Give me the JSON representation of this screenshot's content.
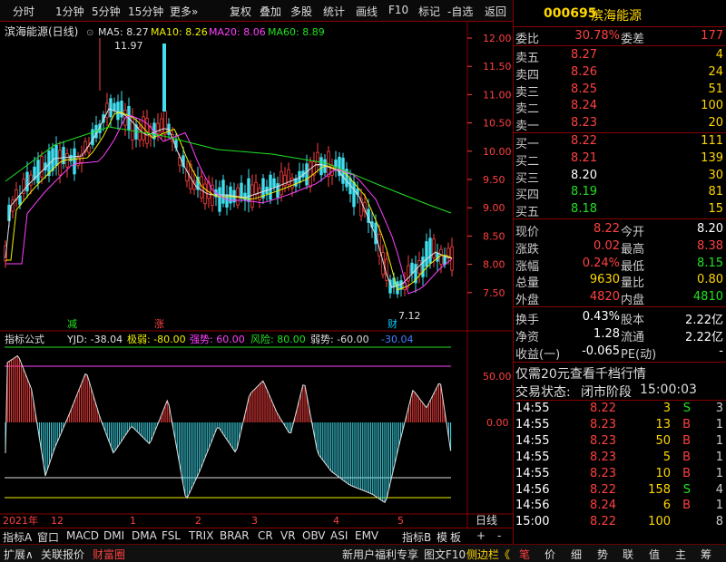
{
  "toolbar": {
    "items": [
      "分时",
      "1分钟",
      "5分钟",
      "15分钟",
      "更多»",
      "复权",
      "叠加",
      "多股",
      "统计",
      "画线",
      "F10",
      "标记",
      "-自选",
      "返回"
    ]
  },
  "chart_header": {
    "title": "滨海能源(日线)",
    "ma5": "MA5: 8.27",
    "ma10": "MA10: 8.26",
    "ma20": "MA20: 8.06",
    "ma60": "MA60: 8.89",
    "high_label": "11.97",
    "low_label": "7.12",
    "mark_jian": "减",
    "mark_zhang": "涨",
    "mark_cai": "财"
  },
  "price_axis": [
    "12.00",
    "11.50",
    "11.00",
    "10.50",
    "10.00",
    "9.50",
    "9.00",
    "8.50",
    "8.00",
    "7.50"
  ],
  "indicator": {
    "name": "指标公式",
    "yjd": "YJD: -38.04",
    "jiruo": "极弱: -80.00",
    "qiangshi": "强势: 60.00",
    "fengxian": "风险: 80.00",
    "ruoshi": "弱势: -60.00",
    "value": "-30.04",
    "axis": [
      "50.00",
      "0.00"
    ]
  },
  "time_axis": {
    "labels": [
      "2021年",
      "12",
      "1",
      "2",
      "3",
      "4",
      "5"
    ],
    "mode": "日线"
  },
  "tabs": [
    "指标A",
    "窗口",
    "MACD",
    "DMI",
    "DMA",
    "FSL",
    "TRIX",
    "BRAR",
    "CR",
    "VR",
    "OBV",
    "ASI",
    "EMV",
    "指标B",
    "模",
    "板",
    "+",
    "-"
  ],
  "footer": {
    "left": [
      "扩展∧",
      "关联报价",
      "财富圈"
    ],
    "news": "新用户福利专享",
    "f10": "图文F10",
    "side": "侧边栏《",
    "right_tabs": [
      "笔",
      "价",
      "细",
      "势",
      "联",
      "值",
      "主",
      "筹"
    ]
  },
  "quote": {
    "code": "000695",
    "name": "滨海能源",
    "weibi_label": "委比",
    "weibi": "30.78%",
    "weicha_label": "委差",
    "weicha": "177",
    "asks": [
      {
        "label": "卖五",
        "price": "8.27",
        "vol": "4"
      },
      {
        "label": "卖四",
        "price": "8.26",
        "vol": "24"
      },
      {
        "label": "卖三",
        "price": "8.25",
        "vol": "51"
      },
      {
        "label": "卖二",
        "price": "8.24",
        "vol": "100"
      },
      {
        "label": "卖一",
        "price": "8.23",
        "vol": "20"
      }
    ],
    "bids": [
      {
        "label": "买一",
        "price": "8.22",
        "vol": "111"
      },
      {
        "label": "买二",
        "price": "8.21",
        "vol": "139"
      },
      {
        "label": "买三",
        "price": "8.20",
        "vol": "30"
      },
      {
        "label": "买四",
        "price": "8.19",
        "vol": "81"
      },
      {
        "label": "买五",
        "price": "8.18",
        "vol": "15"
      }
    ],
    "stats": [
      {
        "l1": "现价",
        "v1": "8.22",
        "c1": "red",
        "l2": "今开",
        "v2": "8.20",
        "c2": "white"
      },
      {
        "l1": "涨跌",
        "v1": "0.02",
        "c1": "red",
        "l2": "最高",
        "v2": "8.38",
        "c2": "red"
      },
      {
        "l1": "涨幅",
        "v1": "0.24%",
        "c1": "red",
        "l2": "最低",
        "v2": "8.15",
        "c2": "green"
      },
      {
        "l1": "总量",
        "v1": "9630",
        "c1": "yellow",
        "l2": "量比",
        "v2": "0.80",
        "c2": "yellow"
      },
      {
        "l1": "外盘",
        "v1": "4820",
        "c1": "red",
        "l2": "内盘",
        "v2": "4810",
        "c2": "green"
      }
    ],
    "stats2": [
      {
        "l1": "换手",
        "v1": "0.43%",
        "l2": "股本",
        "v2": "2.22亿"
      },
      {
        "l1": "净资",
        "v1": "1.28",
        "l2": "流通",
        "v2": "2.22亿"
      },
      {
        "l1": "收益(一)",
        "v1": "-0.065",
        "l2": "PE(动)",
        "v2": "-"
      }
    ],
    "promo": "仅需20元查看千档行情",
    "status_label": "交易状态:",
    "status": "闭市阶段",
    "status_time": "15:00:03",
    "ticks": [
      {
        "t": "14:55",
        "p": "8.22",
        "v": "3",
        "s": "S",
        "n": "3"
      },
      {
        "t": "14:55",
        "p": "8.23",
        "v": "13",
        "s": "B",
        "n": "1"
      },
      {
        "t": "14:55",
        "p": "8.23",
        "v": "50",
        "s": "B",
        "n": "1"
      },
      {
        "t": "14:55",
        "p": "8.23",
        "v": "5",
        "s": "B",
        "n": "1"
      },
      {
        "t": "14:55",
        "p": "8.23",
        "v": "10",
        "s": "B",
        "n": "1"
      },
      {
        "t": "14:56",
        "p": "8.22",
        "v": "158",
        "s": "S",
        "n": "4"
      },
      {
        "t": "14:56",
        "p": "8.24",
        "v": "6",
        "s": "B",
        "n": "1"
      },
      {
        "t": "15:00",
        "p": "8.22",
        "v": "100",
        "s": "",
        "n": "8"
      }
    ]
  }
}
